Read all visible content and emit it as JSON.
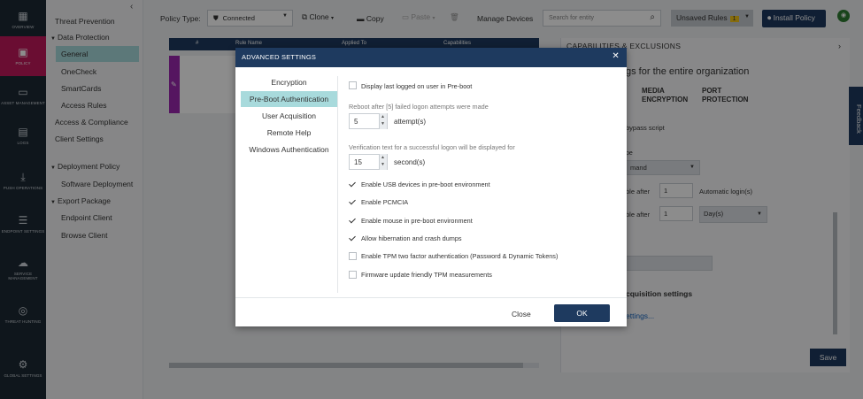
{
  "rail": [
    {
      "label": "OVERVIEW",
      "icon": "grid-icon"
    },
    {
      "label": "POLICY",
      "icon": "policy-icon"
    },
    {
      "label": "ASSET MANAGEMENT",
      "icon": "monitor-icon"
    },
    {
      "label": "LOGS",
      "icon": "logs-icon"
    },
    {
      "label": "PUSH OPERATIONS",
      "icon": "download-icon"
    },
    {
      "label": "ENDPOINT SETTINGS",
      "icon": "sliders-icon"
    },
    {
      "label": "SERVICE MANAGEMENT",
      "icon": "cloud-icon"
    },
    {
      "label": "THREAT HUNTING",
      "icon": "target-icon"
    },
    {
      "label": "GLOBAL SETTINGS",
      "icon": "gear-icon"
    }
  ],
  "tree": {
    "threat_prevention": "Threat Prevention",
    "data_protection": "Data Protection",
    "general": "General",
    "onecheck": "OneCheck",
    "smartcards": "SmartCards",
    "access_rules": "Access Rules",
    "access_compliance": "Access & Compliance",
    "client_settings": "Client Settings",
    "deployment_policy": "Deployment Policy",
    "software_deployment": "Software Deployment",
    "export_package": "Export Package",
    "endpoint_client": "Endpoint Client",
    "browse_client": "Browse Client"
  },
  "toolbar": {
    "policy_type_label": "Policy Type:",
    "policy_type_value": "Connected",
    "clone": "Clone",
    "copy": "Copy",
    "paste": "Paste",
    "manage_devices": "Manage Devices",
    "search_placeholder": "Search for entity",
    "unsaved_rules": "Unsaved Rules",
    "unsaved_count": "1",
    "install_policy": "Install Policy"
  },
  "table": {
    "col_num": "#",
    "col_rule_name": "Rule Name",
    "col_applied_to": "Applied To",
    "col_capabilities": "Capabilities"
  },
  "right_panel": {
    "title": "CAPABILITIES & EXCLUSIONS",
    "heading": "gs for the entire organization",
    "tab_media": "MEDIA\nENCRYPTION",
    "tab_port": "PORT\nPROTECTION",
    "bypass": "bypass script",
    "pe": "pe",
    "command": "mand",
    "enable_after_1": "ble after",
    "value_1": "1",
    "auto_login": "Automatic login(s)",
    "enable_after_2": "ble after",
    "value_2": "1",
    "days": "Day(s)",
    "acq_settings": "cquisition settings",
    "link_settings": "ettings...",
    "save": "Save",
    "feedback": "Feedback"
  },
  "modal": {
    "title": "ADVANCED SETTINGS",
    "nav": [
      "Encryption",
      "Pre-Boot Authentication",
      "User Acquisition",
      "Remote Help",
      "Windows Authentication"
    ],
    "display_last_logged": "Display last logged on user in Pre-boot",
    "reboot_label": "Reboot after [5] failed logon attempts were made",
    "reboot_value": "5",
    "reboot_unit": "attempt(s)",
    "verify_label": "Verification text for a successful logon will be displayed for",
    "verify_value": "15",
    "verify_unit": "second(s)",
    "options": [
      {
        "label": "Enable USB devices in pre-boot environment",
        "checked": true
      },
      {
        "label": "Enable PCMCIA",
        "checked": true
      },
      {
        "label": "Enable mouse in pre-boot environment",
        "checked": true
      },
      {
        "label": "Allow hibernation and crash dumps",
        "checked": true
      },
      {
        "label": "Enable TPM two factor authentication (Password & Dynamic Tokens)",
        "checked": false
      },
      {
        "label": "Firmware update friendly TPM measurements",
        "checked": false
      }
    ],
    "close": "Close",
    "ok": "OK"
  },
  "colors": {
    "navy": "#1e3a5f",
    "rail": "#1c2833",
    "accent": "#c2185b",
    "selected": "#a8dadc"
  }
}
